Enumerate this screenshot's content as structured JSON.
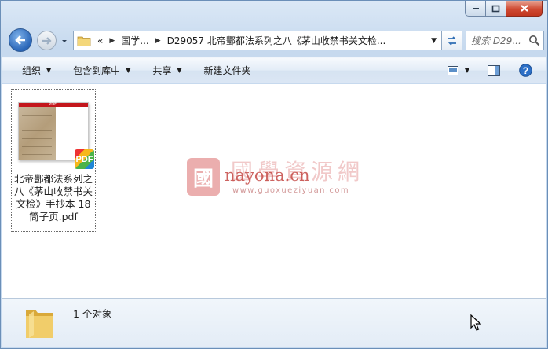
{
  "window": {
    "colors": {
      "accent": "#2a66b8",
      "close": "#cf4a32",
      "selection_border": "#6c6c6c"
    }
  },
  "address_bar": {
    "overflow": "«",
    "crumbs": [
      "国学...",
      "D29057 北帝酆都法系列之八《茅山收禁书关文检..."
    ],
    "search_placeholder": "搜索 D29..."
  },
  "toolbar": {
    "organize": "组织",
    "include_in_library": "包含到库中",
    "share": "共享",
    "new_folder": "新建文件夹"
  },
  "files": [
    {
      "name": "北帝酆都法系列之八《茅山收禁书关文检》手抄本 18筒子页.pdf",
      "type_badge": "PDF",
      "thumb_banner": "PDF"
    }
  ],
  "watermark": {
    "seal": "國",
    "chinese": "國學資源網",
    "site": "nayona.cn",
    "url": "www.guoxueziyuan.com"
  },
  "details": {
    "status": "1 个对象"
  }
}
